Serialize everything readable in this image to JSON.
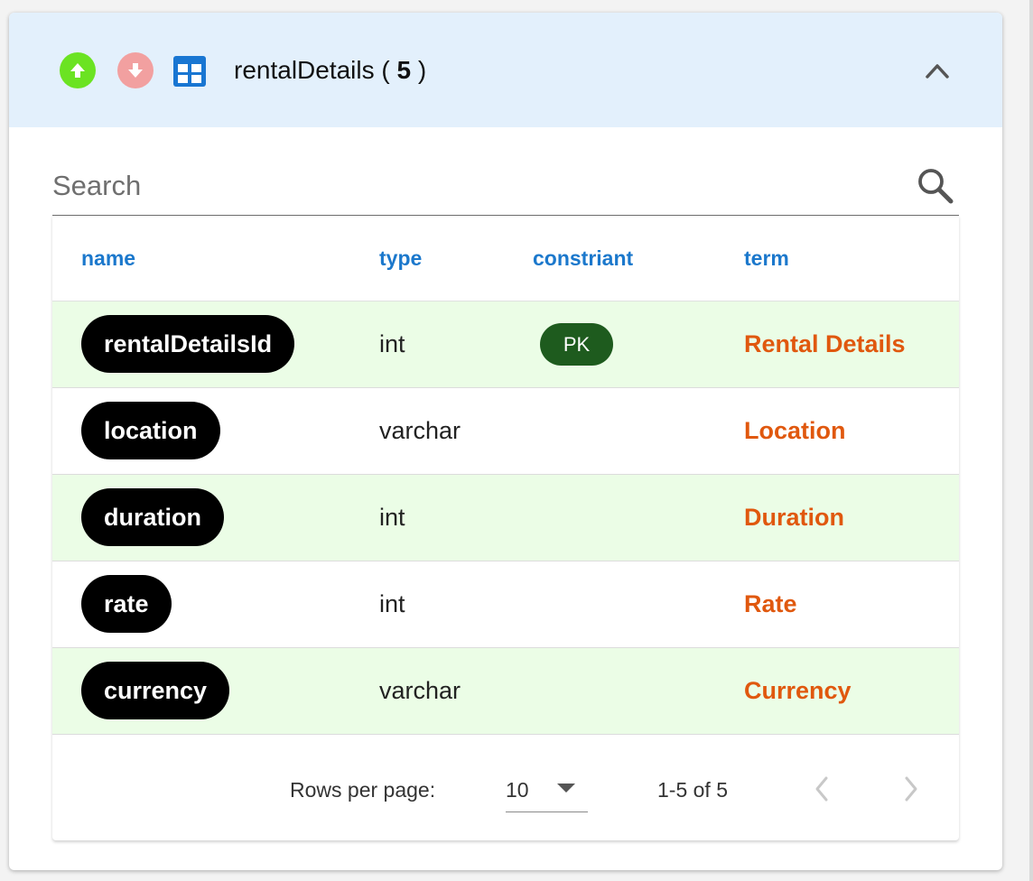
{
  "header": {
    "title": "rentalDetails",
    "count": "5",
    "open_paren": "(",
    "close_paren": ")",
    "up_icon": "arrow-up-circle-icon",
    "down_icon": "arrow-down-circle-icon",
    "table_icon": "table-view-icon",
    "collapse_icon": "chevron-up-icon"
  },
  "search": {
    "placeholder": "Search",
    "value": ""
  },
  "table": {
    "columns": [
      "name",
      "type",
      "constriant",
      "term"
    ],
    "rows": [
      {
        "name": "rentalDetailsId",
        "type": "int",
        "constraint": "PK",
        "term": "Rental Details"
      },
      {
        "name": "location",
        "type": "varchar",
        "constraint": "",
        "term": "Location"
      },
      {
        "name": "duration",
        "type": "int",
        "constraint": "",
        "term": "Duration"
      },
      {
        "name": "rate",
        "type": "int",
        "constraint": "",
        "term": "Rate"
      },
      {
        "name": "currency",
        "type": "varchar",
        "constraint": "",
        "term": "Currency"
      }
    ]
  },
  "pagination": {
    "rows_per_page_label": "Rows per page:",
    "rows_per_page": "10",
    "range": "1-5 of 5"
  },
  "colors": {
    "header_bg": "#e3f0fc",
    "up_button": "#6be322",
    "down_button": "#f2a0a0",
    "column_header": "#1b78cc",
    "term_text": "#e0580e",
    "pk_badge": "#1e5b1e",
    "alt_row": "#ebfde6"
  }
}
